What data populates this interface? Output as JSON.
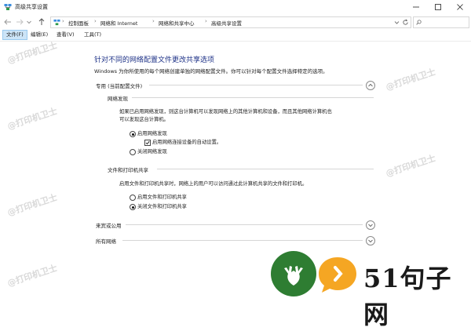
{
  "window": {
    "title": "高级共享设置"
  },
  "address": {
    "crumbs": [
      "控制面板",
      "网络和 Internet",
      "网络和共享中心",
      "高级共享设置"
    ]
  },
  "menu": {
    "items": [
      "文件(F)",
      "编辑(E)",
      "查看(V)",
      "工具(T)"
    ]
  },
  "main": {
    "heading": "针对不同的网络配置文件更改共享选项",
    "description": "Windows 为你所使用的每个网络创建单独的网络配置文件。你可以针对每个配置文件选择特定的选项。",
    "profiles": {
      "private": {
        "title": "专用 (当前配置文件)",
        "discovery": {
          "title": "网络发现",
          "desc_line1": "如果已启用网络发现，则这台计算机可以发现网络上的其他计算机和设备，而且其他网络计算机也",
          "desc_line2": "可以发现这台计算机。",
          "opt_on": "启用网络发现",
          "opt_auto": "启用网络连接设备的自动设置。",
          "opt_off": "关闭网络发现"
        },
        "sharing": {
          "title": "文件和打印机共享",
          "desc": "启用文件和打印机共享时，网络上的用户可以访问通过此计算机共享的文件和打印机。",
          "opt_on": "启用文件和打印机共享",
          "opt_off": "关闭文件和打印机共享"
        }
      },
      "guest": {
        "title": "来宾或公用"
      },
      "all": {
        "title": "所有网络"
      }
    }
  },
  "watermark": {
    "text": "@打印机卫士"
  },
  "logo": {
    "brand": "51句子网"
  },
  "colors": {
    "heading": "#1e3287",
    "accent": "#0078d7",
    "logo_green": "#2e7d32",
    "logo_orange": "#f5a623"
  }
}
